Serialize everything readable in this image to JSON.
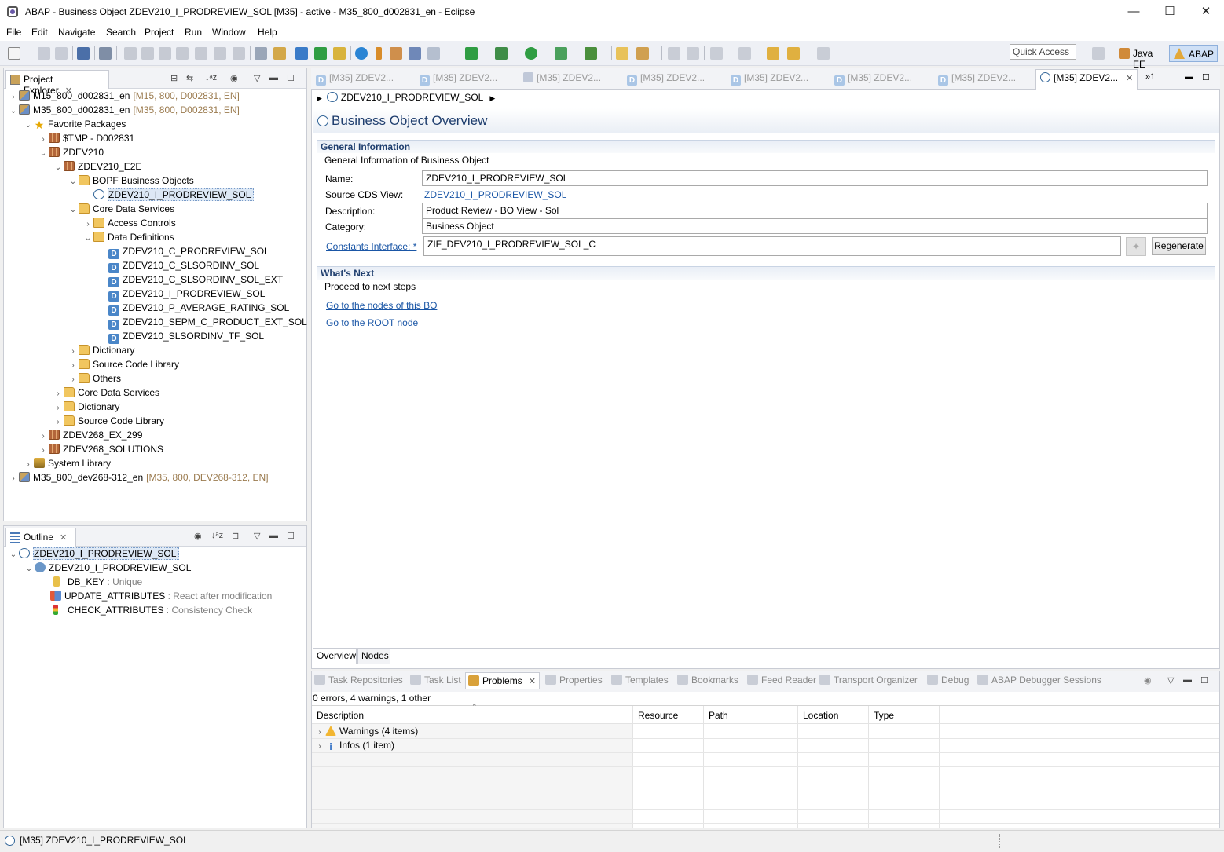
{
  "window": {
    "title": "ABAP - Business Object ZDEV210_I_PRODREVIEW_SOL [M35] - active - M35_800_d002831_en - Eclipse",
    "minimize": "—",
    "maximize": "☐",
    "close": "✕"
  },
  "menu": [
    "File",
    "Edit",
    "Navigate",
    "Search",
    "Project",
    "Run",
    "Window",
    "Help"
  ],
  "toolbar": {
    "quick_access": "Quick Access",
    "perspectives": [
      "Java EE",
      "ABAP"
    ]
  },
  "project_explorer": {
    "tab_label": "Project Explorer",
    "rows": [
      {
        "label": "M15_800_d002831_en",
        "suffix": "[M15, 800, D002831, EN]",
        "icon": "project-icon",
        "twisty": "›"
      },
      {
        "label": "M35_800_d002831_en",
        "suffix": "[M35, 800, D002831, EN]",
        "icon": "project-icon",
        "twisty": "⌄"
      },
      {
        "label": "Favorite Packages",
        "suffix": "",
        "icon": "star-icon",
        "twisty": "⌄"
      },
      {
        "label": "$TMP - D002831",
        "suffix": "",
        "icon": "package-icon",
        "twisty": "›"
      },
      {
        "label": "ZDEV210",
        "suffix": "",
        "icon": "package-icon",
        "twisty": "⌄"
      },
      {
        "label": "ZDEV210_E2E",
        "suffix": "",
        "icon": "package-icon",
        "twisty": "⌄"
      },
      {
        "label": "BOPF Business Objects",
        "suffix": "",
        "icon": "folder-icon",
        "twisty": "⌄"
      },
      {
        "label": "ZDEV210_I_PRODREVIEW_SOL",
        "suffix": "",
        "icon": "business-object-icon",
        "twisty": ""
      },
      {
        "label": "Core Data Services",
        "suffix": "",
        "icon": "folder-icon",
        "twisty": "⌄"
      },
      {
        "label": "Access Controls",
        "suffix": "",
        "icon": "folder-icon",
        "twisty": "›"
      },
      {
        "label": "Data Definitions",
        "suffix": "",
        "icon": "folder-icon",
        "twisty": "⌄"
      },
      {
        "label": "ZDEV210_C_PRODREVIEW_SOL",
        "suffix": "",
        "icon": "data-definition-icon",
        "twisty": ""
      },
      {
        "label": "ZDEV210_C_SLSORDINV_SOL",
        "suffix": "",
        "icon": "data-definition-icon",
        "twisty": ""
      },
      {
        "label": "ZDEV210_C_SLSORDINV_SOL_EXT",
        "suffix": "",
        "icon": "data-definition-icon",
        "twisty": ""
      },
      {
        "label": "ZDEV210_I_PRODREVIEW_SOL",
        "suffix": "",
        "icon": "data-definition-icon",
        "twisty": ""
      },
      {
        "label": "ZDEV210_P_AVERAGE_RATING_SOL",
        "suffix": "",
        "icon": "data-definition-icon",
        "twisty": ""
      },
      {
        "label": "ZDEV210_SEPM_C_PRODUCT_EXT_SOL",
        "suffix": "",
        "icon": "data-definition-icon",
        "twisty": ""
      },
      {
        "label": "ZDEV210_SLSORDINV_TF_SOL",
        "suffix": "",
        "icon": "data-definition-icon",
        "twisty": ""
      },
      {
        "label": "Dictionary",
        "suffix": "",
        "icon": "folder-icon",
        "twisty": "›"
      },
      {
        "label": "Source Code Library",
        "suffix": "",
        "icon": "folder-icon",
        "twisty": "›"
      },
      {
        "label": "Others",
        "suffix": "",
        "icon": "folder-icon",
        "twisty": "›"
      },
      {
        "label": "Core Data Services",
        "suffix": "",
        "icon": "folder-icon",
        "twisty": "›"
      },
      {
        "label": "Dictionary",
        "suffix": "",
        "icon": "folder-icon",
        "twisty": "›"
      },
      {
        "label": "Source Code Library",
        "suffix": "",
        "icon": "folder-icon",
        "twisty": "›"
      },
      {
        "label": "ZDEV268_EX_299",
        "suffix": "",
        "icon": "package-icon",
        "twisty": "›"
      },
      {
        "label": "ZDEV268_SOLUTIONS",
        "suffix": "",
        "icon": "package-icon",
        "twisty": "›"
      },
      {
        "label": "System Library",
        "suffix": "",
        "icon": "system-library-icon",
        "twisty": "›"
      },
      {
        "label": "M35_800_dev268-312_en",
        "suffix": "[M35, 800, DEV268-312, EN]",
        "icon": "project-icon",
        "twisty": "›"
      }
    ]
  },
  "outline": {
    "tab_label": "Outline",
    "rows": [
      {
        "label": "ZDEV210_I_PRODREVIEW_SOL",
        "detail": ""
      },
      {
        "label": "ZDEV210_I_PRODREVIEW_SOL",
        "detail": ""
      },
      {
        "label": "DB_KEY",
        "detail": " : Unique"
      },
      {
        "label": "UPDATE_ATTRIBUTES",
        "detail": " : React after modification"
      },
      {
        "label": "CHECK_ATTRIBUTES",
        "detail": " : Consistency Check"
      }
    ]
  },
  "editor": {
    "tabs": [
      "[M35] ZDEV2...",
      "[M35] ZDEV2...",
      "[M35] ZDEV2...",
      "[M35] ZDEV2...",
      "[M35] ZDEV2...",
      "[M35] ZDEV2...",
      "[M35] ZDEV2...",
      "[M35] ZDEV2..."
    ],
    "overflow": "»1",
    "breadcrumb": "ZDEV210_I_PRODREVIEW_SOL",
    "page_title": "Business Object Overview",
    "general": {
      "header": "General Information",
      "subtitle": "General Information of Business Object",
      "name_label": "Name:",
      "name_value": "ZDEV210_I_PRODREVIEW_SOL",
      "cds_label": "Source CDS View:",
      "cds_value": "ZDEV210_I_PRODREVIEW_SOL",
      "description_label": "Description:",
      "description_value": "Product Review - BO View - Sol",
      "category_label": "Category:",
      "category_value": "Business Object",
      "constants_label": "Constants Interface: *",
      "constants_value": "ZIF_DEV210_I_PRODREVIEW_SOL_C",
      "regenerate": "Regenerate"
    },
    "whats_next": {
      "header": "What's Next",
      "subtitle": "Proceed to next steps",
      "link1": "Go to the nodes of this BO",
      "link2": "Go to the ROOT node"
    },
    "bottom_tabs": [
      "Overview",
      "Nodes"
    ]
  },
  "bottom_panel": {
    "tabs": [
      "Task Repositories",
      "Task List",
      "Problems",
      "Properties",
      "Templates",
      "Bookmarks",
      "Feed Reader",
      "Transport Organizer",
      "Debug",
      "ABAP Debugger Sessions"
    ],
    "summary": "0 errors, 4 warnings, 1 other",
    "columns": [
      "Description",
      "Resource",
      "Path",
      "Location",
      "Type"
    ],
    "rows": [
      {
        "label": "Warnings (4 items)"
      },
      {
        "label": "Infos (1 item)"
      }
    ]
  },
  "status": "[M35] ZDEV210_I_PRODREVIEW_SOL"
}
